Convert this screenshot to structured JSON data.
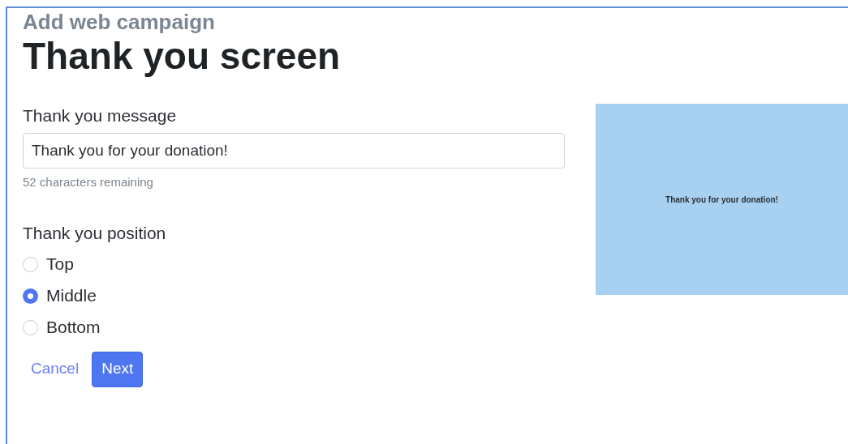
{
  "header": {
    "subtitle": "Add web campaign",
    "title": "Thank you screen"
  },
  "message_field": {
    "label": "Thank you message",
    "value": "Thank you for your donation!",
    "hint": "52 characters remaining"
  },
  "position": {
    "label": "Thank you position",
    "options": [
      {
        "label": "Top",
        "selected": false
      },
      {
        "label": "Middle",
        "selected": true
      },
      {
        "label": "Bottom",
        "selected": false
      }
    ]
  },
  "buttons": {
    "cancel": "Cancel",
    "next": "Next"
  },
  "preview": {
    "message": "Thank you for your donation!"
  }
}
